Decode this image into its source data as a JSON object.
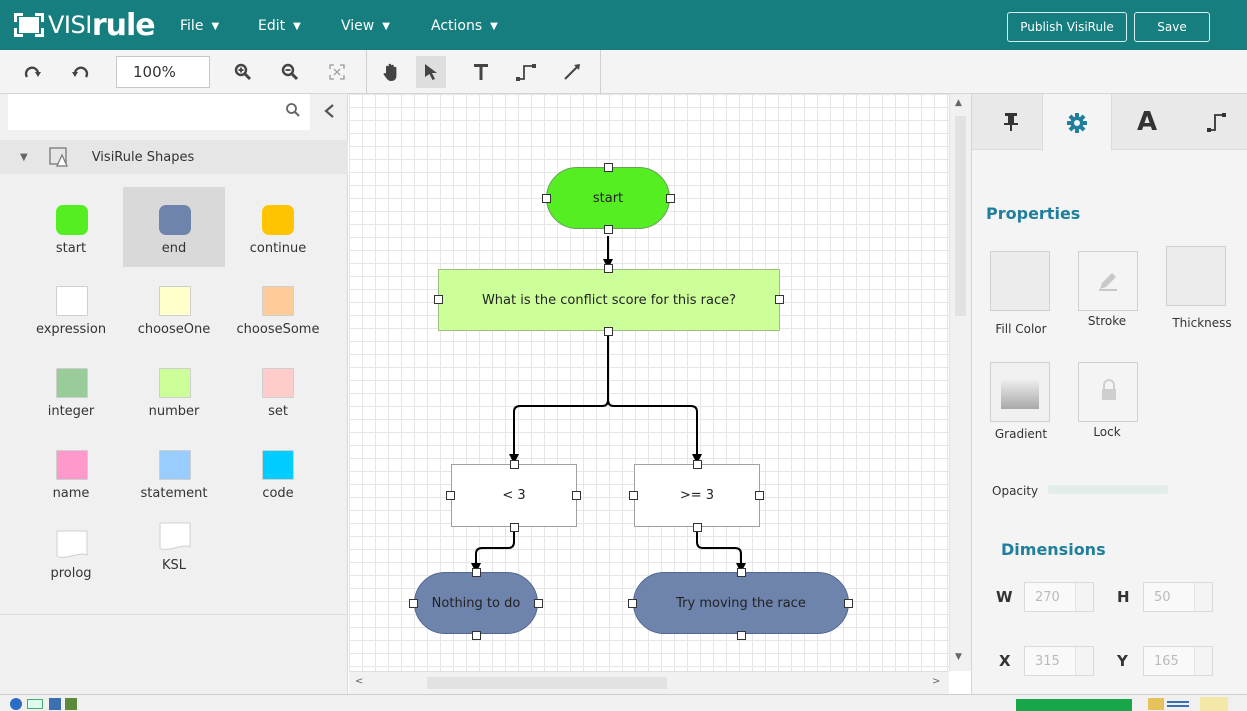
{
  "app": {
    "logo_visi": "VISI",
    "logo_rule": "rule",
    "menus": [
      {
        "label": "File"
      },
      {
        "label": "Edit"
      },
      {
        "label": "View"
      },
      {
        "label": "Actions"
      }
    ],
    "publish_label": "Publish VisiRule",
    "save_label": "Save"
  },
  "toolbar": {
    "zoom_value": "100%",
    "icons": [
      "redo-icon",
      "undo-icon",
      "zoom-in-icon",
      "zoom-out-icon",
      "fit-icon",
      "pan-icon",
      "select-icon",
      "text-icon",
      "connector-icon",
      "line-icon"
    ]
  },
  "left_panel": {
    "search_placeholder": "",
    "group_title": "VisiRule Shapes",
    "shapes": [
      {
        "label": "start",
        "color": "#55ee22"
      },
      {
        "label": "end",
        "color": "#6f84ad"
      },
      {
        "label": "continue",
        "color": "#ffc400"
      },
      {
        "label": "expression",
        "color": "#ffffff"
      },
      {
        "label": "chooseOne",
        "color": "#ffffcc"
      },
      {
        "label": "chooseSome",
        "color": "#ffcc99"
      },
      {
        "label": "integer",
        "color": "#99cc99"
      },
      {
        "label": "number",
        "color": "#ccff99"
      },
      {
        "label": "set",
        "color": "#ffcccc"
      },
      {
        "label": "name",
        "color": "#ff99cc"
      },
      {
        "label": "statement",
        "color": "#99ccff"
      },
      {
        "label": "code",
        "color": "#00ccff"
      },
      {
        "label": "prolog",
        "color": "#ffffff"
      },
      {
        "label": "KSL",
        "color": "#ffffff"
      }
    ]
  },
  "diagram": {
    "start": {
      "label": "start",
      "color": "#55ee22"
    },
    "question": {
      "label": "What is the conflict score for this race?",
      "color": "#ccff99"
    },
    "cond_lt": {
      "label": "< 3"
    },
    "cond_ge": {
      "label": ">= 3"
    },
    "end_nothing": {
      "label": "Nothing to do",
      "color": "#6f84ad"
    },
    "end_move": {
      "label": "Try moving the race",
      "color": "#6f84ad"
    }
  },
  "right_panel": {
    "tabs": [
      "pin-icon",
      "gear-icon",
      "font-icon",
      "connector-icon"
    ],
    "properties_title": "Properties",
    "fill_label": "Fill Color",
    "stroke_label": "Stroke",
    "thickness_label": "Thickness",
    "gradient_label": "Gradient",
    "lock_label": "Lock",
    "opacity_label": "Opacity",
    "dimensions_title": "Dimensions",
    "w_label": "W",
    "w_value": "270",
    "h_label": "H",
    "h_value": "50",
    "x_label": "X",
    "x_value": "315",
    "y_label": "Y",
    "y_value": "165"
  }
}
